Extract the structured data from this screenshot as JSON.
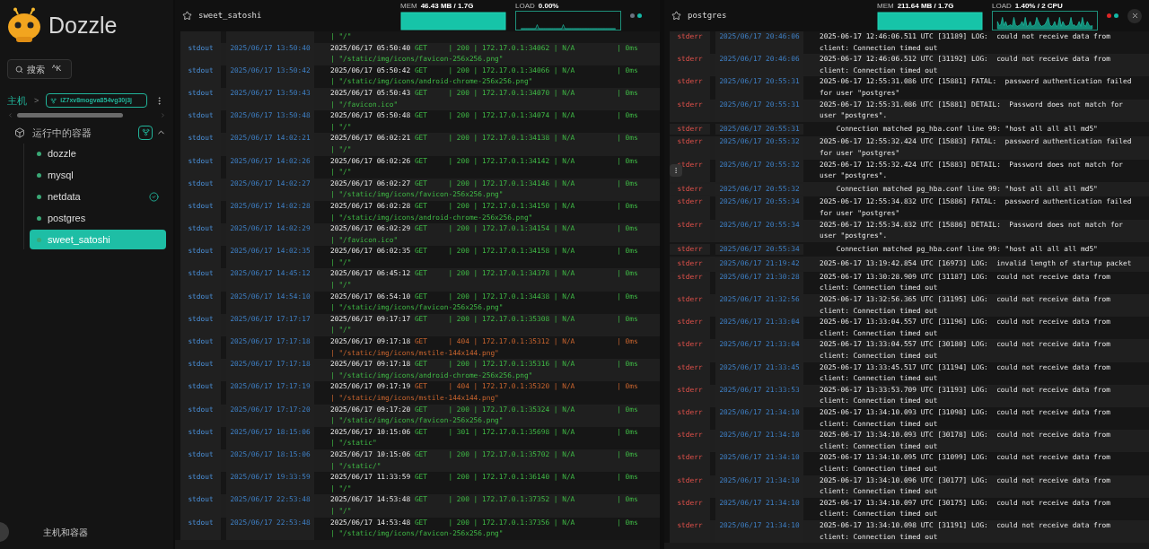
{
  "sidebar": {
    "app_name": "Dozzle",
    "search": {
      "label": "搜索",
      "shortcut": "^K"
    },
    "host": {
      "label": "主机",
      "separator": ">",
      "name": "iZ7xv8mogva854vg30j3j"
    },
    "section": {
      "title": "运行中的容器",
      "expanded": true
    },
    "containers": [
      {
        "name": "dozzle",
        "selected": false,
        "healthy": false
      },
      {
        "name": "mysql",
        "selected": false,
        "healthy": false
      },
      {
        "name": "netdata",
        "selected": false,
        "healthy": true
      },
      {
        "name": "postgres",
        "selected": false,
        "healthy": false
      },
      {
        "name": "sweet_satoshi",
        "selected": true,
        "healthy": false
      }
    ],
    "footer": "主机和容器"
  },
  "panels": [
    {
      "name": "sweet_satoshi",
      "kind": "out",
      "closable": false,
      "mem": {
        "label": "MEM",
        "value": "46.43 MB / 1.7G"
      },
      "load": {
        "label": "LOAD",
        "value": "0.00%"
      },
      "indicators": [
        {
          "color": "#6b7280"
        },
        {
          "color": "#14b8a6"
        }
      ],
      "entries": [
        {
          "path": "| \"/\"",
          "kind": "ok"
        },
        {
          "stream": "stdout",
          "time": "2025/06/17 13:50:40",
          "stamp": "2025/06/17 05:50:40",
          "request": "GET     | 200 | 172.17.0.1:34062 | N/A          | 0ms",
          "path": "| \"/static/img/icons/favicon-256x256.png\"",
          "kind": "ok"
        },
        {
          "stream": "stdout",
          "time": "2025/06/17 13:50:42",
          "stamp": "2025/06/17 05:50:42",
          "request": "GET     | 200 | 172.17.0.1:34066 | N/A          | 0ms",
          "path": "| \"/static/img/icons/android-chrome-256x256.png\"",
          "kind": "ok"
        },
        {
          "stream": "stdout",
          "time": "2025/06/17 13:50:43",
          "stamp": "2025/06/17 05:50:43",
          "request": "GET     | 200 | 172.17.0.1:34070 | N/A          | 0ms",
          "path": "| \"/favicon.ico\"",
          "kind": "ok"
        },
        {
          "stream": "stdout",
          "time": "2025/06/17 13:50:48",
          "stamp": "2025/06/17 05:50:48",
          "request": "GET     | 200 | 172.17.0.1:34074 | N/A          | 0ms",
          "path": "| \"/\"",
          "kind": "ok"
        },
        {
          "stream": "stdout",
          "time": "2025/06/17 14:02:21",
          "stamp": "2025/06/17 06:02:21",
          "request": "GET     | 200 | 172.17.0.1:34138 | N/A          | 0ms",
          "path": "| \"/\"",
          "kind": "ok"
        },
        {
          "stream": "stdout",
          "time": "2025/06/17 14:02:26",
          "stamp": "2025/06/17 06:02:26",
          "request": "GET     | 200 | 172.17.0.1:34142 | N/A          | 0ms",
          "path": "| \"/\"",
          "kind": "ok"
        },
        {
          "stream": "stdout",
          "time": "2025/06/17 14:02:27",
          "stamp": "2025/06/17 06:02:27",
          "request": "GET     | 200 | 172.17.0.1:34146 | N/A          | 0ms",
          "path": "| \"/static/img/icons/favicon-256x256.png\"",
          "kind": "ok"
        },
        {
          "stream": "stdout",
          "time": "2025/06/17 14:02:28",
          "stamp": "2025/06/17 06:02:28",
          "request": "GET     | 200 | 172.17.0.1:34150 | N/A          | 0ms",
          "path": "| \"/static/img/icons/android-chrome-256x256.png\"",
          "kind": "ok"
        },
        {
          "stream": "stdout",
          "time": "2025/06/17 14:02:29",
          "stamp": "2025/06/17 06:02:29",
          "request": "GET     | 200 | 172.17.0.1:34154 | N/A          | 0ms",
          "path": "| \"/favicon.ico\"",
          "kind": "ok"
        },
        {
          "stream": "stdout",
          "time": "2025/06/17 14:02:35",
          "stamp": "2025/06/17 06:02:35",
          "request": "GET     | 200 | 172.17.0.1:34158 | N/A          | 0ms",
          "path": "| \"/\"",
          "kind": "ok"
        },
        {
          "stream": "stdout",
          "time": "2025/06/17 14:45:12",
          "stamp": "2025/06/17 06:45:12",
          "request": "GET     | 200 | 172.17.0.1:34378 | N/A          | 0ms",
          "path": "| \"/\"",
          "kind": "ok"
        },
        {
          "stream": "stdout",
          "time": "2025/06/17 14:54:10",
          "stamp": "2025/06/17 06:54:10",
          "request": "GET     | 200 | 172.17.0.1:34438 | N/A          | 0ms",
          "path": "| \"/static/img/icons/favicon-256x256.png\"",
          "kind": "ok"
        },
        {
          "stream": "stdout",
          "time": "2025/06/17 17:17:17",
          "stamp": "2025/06/17 09:17:17",
          "request": "GET     | 200 | 172.17.0.1:35308 | N/A          | 0ms",
          "path": "| \"/\"",
          "kind": "ok"
        },
        {
          "stream": "stdout",
          "time": "2025/06/17 17:17:18",
          "stamp": "2025/06/17 09:17:18",
          "request": "GET     | 404 | 172.17.0.1:35312 | N/A          | 0ms",
          "path": "| \"/static/img/icons/mstile-144x144.png\"",
          "kind": "error"
        },
        {
          "stream": "stdout",
          "time": "2025/06/17 17:17:18",
          "stamp": "2025/06/17 09:17:18",
          "request": "GET     | 200 | 172.17.0.1:35316 | N/A          | 0ms",
          "path": "| \"/static/img/icons/android-chrome-256x256.png\"",
          "kind": "ok"
        },
        {
          "stream": "stdout",
          "time": "2025/06/17 17:17:19",
          "stamp": "2025/06/17 09:17:19",
          "request": "GET     | 404 | 172.17.0.1:35320 | N/A          | 0ms",
          "path": "| \"/static/img/icons/mstile-144x144.png\"",
          "kind": "error"
        },
        {
          "stream": "stdout",
          "time": "2025/06/17 17:17:20",
          "stamp": "2025/06/17 09:17:20",
          "request": "GET     | 200 | 172.17.0.1:35324 | N/A          | 0ms",
          "path": "| \"/static/img/icons/favicon-256x256.png\"",
          "kind": "ok"
        },
        {
          "stream": "stdout",
          "time": "2025/06/17 18:15:06",
          "stamp": "2025/06/17 10:15:06",
          "request": "GET     | 301 | 172.17.0.1:35698 | N/A          | 0ms",
          "path": "| \"/static\"",
          "kind": "ok"
        },
        {
          "stream": "stdout",
          "time": "2025/06/17 18:15:06",
          "stamp": "2025/06/17 10:15:06",
          "request": "GET     | 200 | 172.17.0.1:35702 | N/A          | 0ms",
          "path": "| \"/static/\"",
          "kind": "ok"
        },
        {
          "stream": "stdout",
          "time": "2025/06/17 19:33:59",
          "stamp": "2025/06/17 11:33:59",
          "request": "GET     | 200 | 172.17.0.1:36140 | N/A          | 0ms",
          "path": "| \"/\"",
          "kind": "ok"
        },
        {
          "stream": "stdout",
          "time": "2025/06/17 22:53:48",
          "stamp": "2025/06/17 14:53:48",
          "request": "GET     | 200 | 172.17.0.1:37352 | N/A          | 0ms",
          "path": "| \"/\"",
          "kind": "ok"
        },
        {
          "stream": "stdout",
          "time": "2025/06/17 22:53:48",
          "stamp": "2025/06/17 14:53:48",
          "request": "GET     | 200 | 172.17.0.1:37356 | N/A          | 0ms",
          "path": "| \"/static/img/icons/favicon-256x256.png\"",
          "kind": "ok"
        }
      ]
    },
    {
      "name": "postgres",
      "kind": "err",
      "closable": true,
      "mem": {
        "label": "MEM",
        "value": "211.64 MB / 1.7G"
      },
      "load": {
        "label": "LOAD",
        "value": "1.40% / 2 CPU"
      },
      "indicators": [
        {
          "color": "#dc2626"
        },
        {
          "color": "#14b8a6"
        }
      ],
      "entries": [
        {
          "stream": "stderr",
          "time": "2025/06/17 20:46:06",
          "lines": [
            "2025-06-17 12:46:06.511 UTC [31189] LOG:  could not receive data from",
            "client: Connection timed out"
          ]
        },
        {
          "stream": "stderr",
          "time": "2025/06/17 20:46:06",
          "lines": [
            "2025-06-17 12:46:06.512 UTC [31192] LOG:  could not receive data from",
            "client: Connection timed out"
          ]
        },
        {
          "stream": "stderr",
          "time": "2025/06/17 20:55:31",
          "lines": [
            "2025-06-17 12:55:31.086 UTC [15881] FATAL:  password authentication failed",
            "for user \"postgres\""
          ]
        },
        {
          "stream": "stderr",
          "time": "2025/06/17 20:55:31",
          "lines": [
            "2025-06-17 12:55:31.086 UTC [15881] DETAIL:  Password does not match for",
            "user \"postgres\"."
          ]
        },
        {
          "stream": "stderr",
          "time": "2025/06/17 20:55:31",
          "lines": [
            "    Connection matched pg_hba.conf line 99: \"host all all all md5\""
          ]
        },
        {
          "stream": "stderr",
          "time": "2025/06/17 20:55:32",
          "lines": [
            "2025-06-17 12:55:32.424 UTC [15883] FATAL:  password authentication failed",
            "for user \"postgres\""
          ]
        },
        {
          "stream": "stderr",
          "time": "2025/06/17 20:55:32",
          "lines": [
            "2025-06-17 12:55:32.424 UTC [15883] DETAIL:  Password does not match for",
            "user \"postgres\"."
          ],
          "menu": true
        },
        {
          "stream": "stderr",
          "time": "2025/06/17 20:55:32",
          "lines": [
            "    Connection matched pg_hba.conf line 99: \"host all all all md5\""
          ]
        },
        {
          "stream": "stderr",
          "time": "2025/06/17 20:55:34",
          "lines": [
            "2025-06-17 12:55:34.832 UTC [15886] FATAL:  password authentication failed",
            "for user \"postgres\""
          ]
        },
        {
          "stream": "stderr",
          "time": "2025/06/17 20:55:34",
          "lines": [
            "2025-06-17 12:55:34.832 UTC [15886] DETAIL:  Password does not match for",
            "user \"postgres\"."
          ]
        },
        {
          "stream": "stderr",
          "time": "2025/06/17 20:55:34",
          "lines": [
            "    Connection matched pg_hba.conf line 99: \"host all all all md5\""
          ]
        },
        {
          "stream": "stderr",
          "time": "2025/06/17 21:19:42",
          "lines": [
            "2025-06-17 13:19:42.854 UTC [16973] LOG:  invalid length of startup packet"
          ]
        },
        {
          "stream": "stderr",
          "time": "2025/06/17 21:30:28",
          "lines": [
            "2025-06-17 13:30:28.909 UTC [31187] LOG:  could not receive data from",
            "client: Connection timed out"
          ]
        },
        {
          "stream": "stderr",
          "time": "2025/06/17 21:32:56",
          "lines": [
            "2025-06-17 13:32:56.365 UTC [31195] LOG:  could not receive data from",
            "client: Connection timed out"
          ]
        },
        {
          "stream": "stderr",
          "time": "2025/06/17 21:33:04",
          "lines": [
            "2025-06-17 13:33:04.557 UTC [31196] LOG:  could not receive data from",
            "client: Connection timed out"
          ]
        },
        {
          "stream": "stderr",
          "time": "2025/06/17 21:33:04",
          "lines": [
            "2025-06-17 13:33:04.557 UTC [30180] LOG:  could not receive data from",
            "client: Connection timed out"
          ]
        },
        {
          "stream": "stderr",
          "time": "2025/06/17 21:33:45",
          "lines": [
            "2025-06-17 13:33:45.517 UTC [31194] LOG:  could not receive data from",
            "client: Connection timed out"
          ]
        },
        {
          "stream": "stderr",
          "time": "2025/06/17 21:33:53",
          "lines": [
            "2025-06-17 13:33:53.709 UTC [31193] LOG:  could not receive data from",
            "client: Connection timed out"
          ]
        },
        {
          "stream": "stderr",
          "time": "2025/06/17 21:34:10",
          "lines": [
            "2025-06-17 13:34:10.093 UTC [31098] LOG:  could not receive data from",
            "client: Connection timed out"
          ]
        },
        {
          "stream": "stderr",
          "time": "2025/06/17 21:34:10",
          "lines": [
            "2025-06-17 13:34:10.093 UTC [30178] LOG:  could not receive data from",
            "client: Connection timed out"
          ]
        },
        {
          "stream": "stderr",
          "time": "2025/06/17 21:34:10",
          "lines": [
            "2025-06-17 13:34:10.095 UTC [31099] LOG:  could not receive data from",
            "client: Connection timed out"
          ]
        },
        {
          "stream": "stderr",
          "time": "2025/06/17 21:34:10",
          "lines": [
            "2025-06-17 13:34:10.096 UTC [30177] LOG:  could not receive data from",
            "client: Connection timed out"
          ]
        },
        {
          "stream": "stderr",
          "time": "2025/06/17 21:34:10",
          "lines": [
            "2025-06-17 13:34:10.097 UTC [30175] LOG:  could not receive data from",
            "client: Connection timed out"
          ]
        },
        {
          "stream": "stderr",
          "time": "2025/06/17 21:34:10",
          "lines": [
            "2025-06-17 13:34:10.098 UTC [31191] LOG:  could not receive data from",
            "client: Connection timed out"
          ]
        }
      ]
    }
  ]
}
